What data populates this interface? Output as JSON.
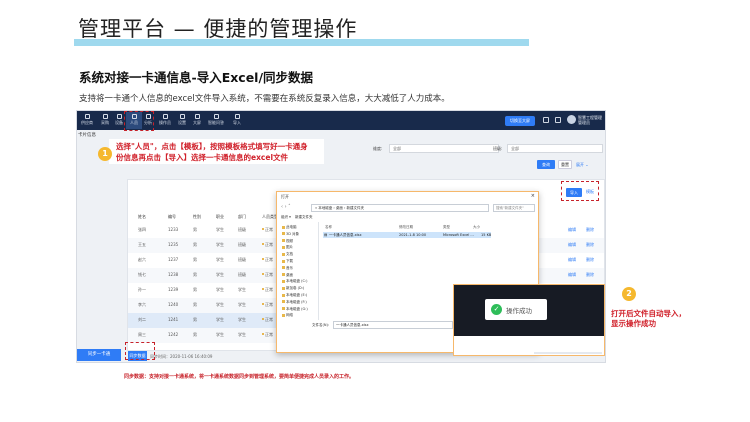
{
  "slide": {
    "title": "管理平台 — 便捷的管理操作",
    "subtitle": "系统对接一卡通信息-导入Excel/同步数据",
    "description": "支持将一卡通个人信息的excel文件导入系统，不需要在系统反复录入信息，大大减低了人力成本。",
    "footer_note": "同步数据：支持对接一卡通系统，将一卡通系统数据同步到管理系统，要简单便捷完成人员录入的工作。",
    "colors": {
      "title_bar": "#9fd9ee",
      "accent_red": "#c7222a",
      "step_badge": "#f5b82e",
      "nav_bg": "#182a4b",
      "primary_blue": "#2f7cf6"
    }
  },
  "annotations": {
    "step1": {
      "number": "1",
      "line1": "选择\"人员\"，点击【模板】，按照模板格式填写好一卡通身",
      "line2": "份信息再点击【导入】选择一卡通信息的excel文件"
    },
    "step2": {
      "number": "2",
      "line1": "打开后文件自动导入，",
      "line2": "显示操作成功"
    }
  },
  "app": {
    "nav": [
      {
        "label": "供应商",
        "icon": "supplier-icon"
      },
      {
        "label": "采购",
        "icon": "purchase-icon"
      },
      {
        "label": "设备",
        "icon": "device-icon"
      },
      {
        "label": "人员",
        "icon": "people-icon"
      },
      {
        "label": "分析",
        "icon": "analysis-icon"
      },
      {
        "label": "操作员",
        "icon": "operator-icon"
      },
      {
        "label": "设置",
        "icon": "settings-icon"
      },
      {
        "label": "大屏",
        "icon": "screen-icon"
      },
      {
        "label": "智能问答",
        "icon": "qa-icon"
      },
      {
        "label": "导入",
        "icon": "import-icon"
      }
    ],
    "nav_blue_button": "切换至大屏",
    "user_name": "智慧工程管理",
    "user_sub": "管理员",
    "page_title": "卡片信息",
    "filters": [
      {
        "label": "维度:",
        "value": "全部"
      },
      {
        "label": "班级:",
        "value": "全部"
      }
    ],
    "buttons": {
      "query": "查询",
      "reset": "重置",
      "expand": "展开",
      "import": "导入",
      "template": "模板",
      "left_bottom": "同步一卡通",
      "sync": "同步数据"
    },
    "sync_time": "同步时间：2020-11-06 16:40:09",
    "table": {
      "headers": [
        "姓名",
        "编号",
        "性别",
        "职业",
        "部门",
        "人员类型"
      ],
      "rows": [
        {
          "name": "张四",
          "id": "1233",
          "sex": "男",
          "job": "学生",
          "dept": "班级",
          "type": "正常"
        },
        {
          "name": "王五",
          "id": "1235",
          "sex": "男",
          "job": "学生",
          "dept": "班级",
          "type": "正常"
        },
        {
          "name": "赵六",
          "id": "1237",
          "sex": "男",
          "job": "学生",
          "dept": "班级",
          "type": "正常"
        },
        {
          "name": "钱七",
          "id": "1238",
          "sex": "男",
          "job": "学生",
          "dept": "班级",
          "type": "正常"
        },
        {
          "name": "孙一",
          "id": "1239",
          "sex": "男",
          "job": "学生",
          "dept": "学生",
          "type": "正常"
        },
        {
          "name": "李六",
          "id": "1240",
          "sex": "男",
          "job": "学生",
          "dept": "学生",
          "type": "正常"
        },
        {
          "name": "刘二",
          "id": "1241",
          "sex": "男",
          "job": "学生",
          "dept": "学生",
          "type": "正常"
        },
        {
          "name": "周三",
          "id": "1242",
          "sex": "男",
          "job": "学生",
          "dept": "学生",
          "type": "正常"
        }
      ],
      "row_action": "编辑",
      "row_action2": "删除"
    },
    "last_row_extra": {
      "phone": "8887785743",
      "date1": "2020-11-05 06:23",
      "date2": "2020-11-05 07:23"
    }
  },
  "dialog": {
    "title": "打开",
    "close": "×",
    "path": "« 本地磁盘 › 桌面 › 新建文件夹",
    "search_placeholder": "搜索\"新建文件夹\"",
    "organize": "组织 ▾",
    "new_folder": "新建文件夹",
    "sidebar": [
      "此电脑",
      "3D 对象",
      "视频",
      "图片",
      "文档",
      "下载",
      "音乐",
      "桌面",
      "本地磁盘 (C:)",
      "新加卷 (D:)",
      "本地磁盘 (E:)",
      "本地磁盘 (F:)",
      "本地磁盘 (G:)",
      "网络"
    ],
    "columns": [
      "名称",
      "修改日期",
      "类型",
      "大小"
    ],
    "file": {
      "name": "一卡通人员信息.xlsx",
      "date": "2021-1-8 10:00",
      "type": "Microsoft Excel ...",
      "size": "15 KB"
    },
    "filename_label": "文件名(N):",
    "filename_value": "一卡通人员信息.xlsx",
    "file_type": "自定义文件 (*.xlsx)",
    "open_button": "打开(O)",
    "cancel_button": "取消"
  },
  "toast": {
    "text": "操作成功",
    "icon": "check-circle-icon"
  }
}
